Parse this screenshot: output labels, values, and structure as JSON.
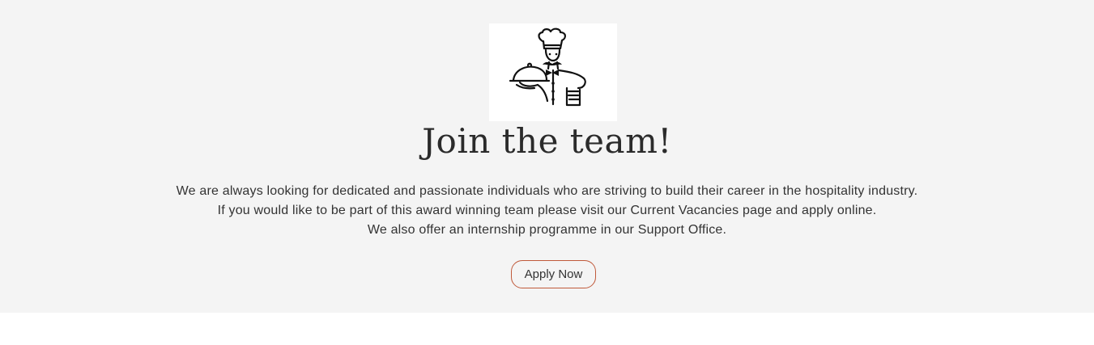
{
  "join": {
    "logo_icon": "chef-with-cloche-icon",
    "title": "Join the team!",
    "paragraphs": [
      "We are always looking for dedicated and passionate individuals who are striving to build their career in the hospitality industry.",
      "If you would like to be part of this award winning team please visit our Current Vacancies page and apply online.",
      "We also offer an internship programme in our Support Office."
    ],
    "apply_label": "Apply Now"
  },
  "colors": {
    "section_bg": "#f4f4f4",
    "page_bg": "#ffffff",
    "text": "#333333",
    "button_border": "#c0593a"
  }
}
